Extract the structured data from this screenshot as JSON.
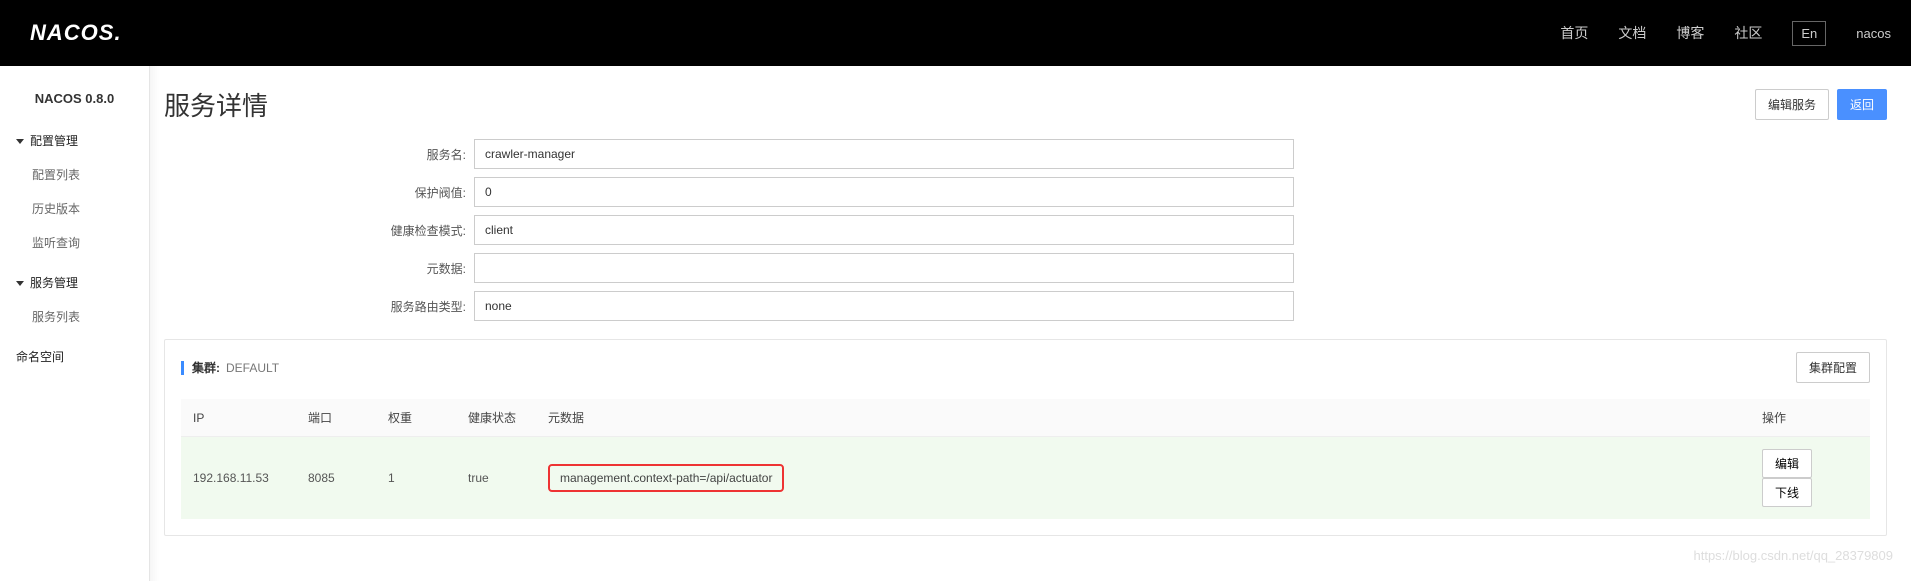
{
  "header": {
    "logo_text": "NACOS.",
    "nav": {
      "home": "首页",
      "docs": "文档",
      "blog": "博客",
      "community": "社区",
      "lang": "En",
      "user": "nacos"
    }
  },
  "sidebar": {
    "version": "NACOS 0.8.0",
    "groups": [
      {
        "label": "配置管理",
        "items": [
          "配置列表",
          "历史版本",
          "监听查询"
        ]
      },
      {
        "label": "服务管理",
        "items": [
          "服务列表"
        ]
      }
    ],
    "namespace_label": "命名空间"
  },
  "page": {
    "title": "服务详情",
    "edit_service_btn": "编辑服务",
    "back_btn": "返回"
  },
  "form": {
    "labels": {
      "service_name": "服务名:",
      "protect_threshold": "保护阀值:",
      "health_check_mode": "健康检查模式:",
      "metadata": "元数据:",
      "route_type": "服务路由类型:"
    },
    "values": {
      "service_name": "crawler-manager",
      "protect_threshold": "0",
      "health_check_mode": "client",
      "metadata": "",
      "route_type": "none"
    }
  },
  "cluster": {
    "label": "集群:",
    "name": "DEFAULT",
    "config_btn": "集群配置",
    "columns": {
      "ip": "IP",
      "port": "端口",
      "weight": "权重",
      "health": "健康状态",
      "metadata": "元数据",
      "ops": "操作"
    },
    "rows": [
      {
        "ip": "192.168.11.53",
        "port": "8085",
        "weight": "1",
        "health": "true",
        "metadata": "management.context-path=/api/actuator"
      }
    ],
    "row_ops": {
      "edit": "编辑",
      "offline": "下线"
    }
  },
  "watermark": "https://blog.csdn.net/qq_28379809"
}
